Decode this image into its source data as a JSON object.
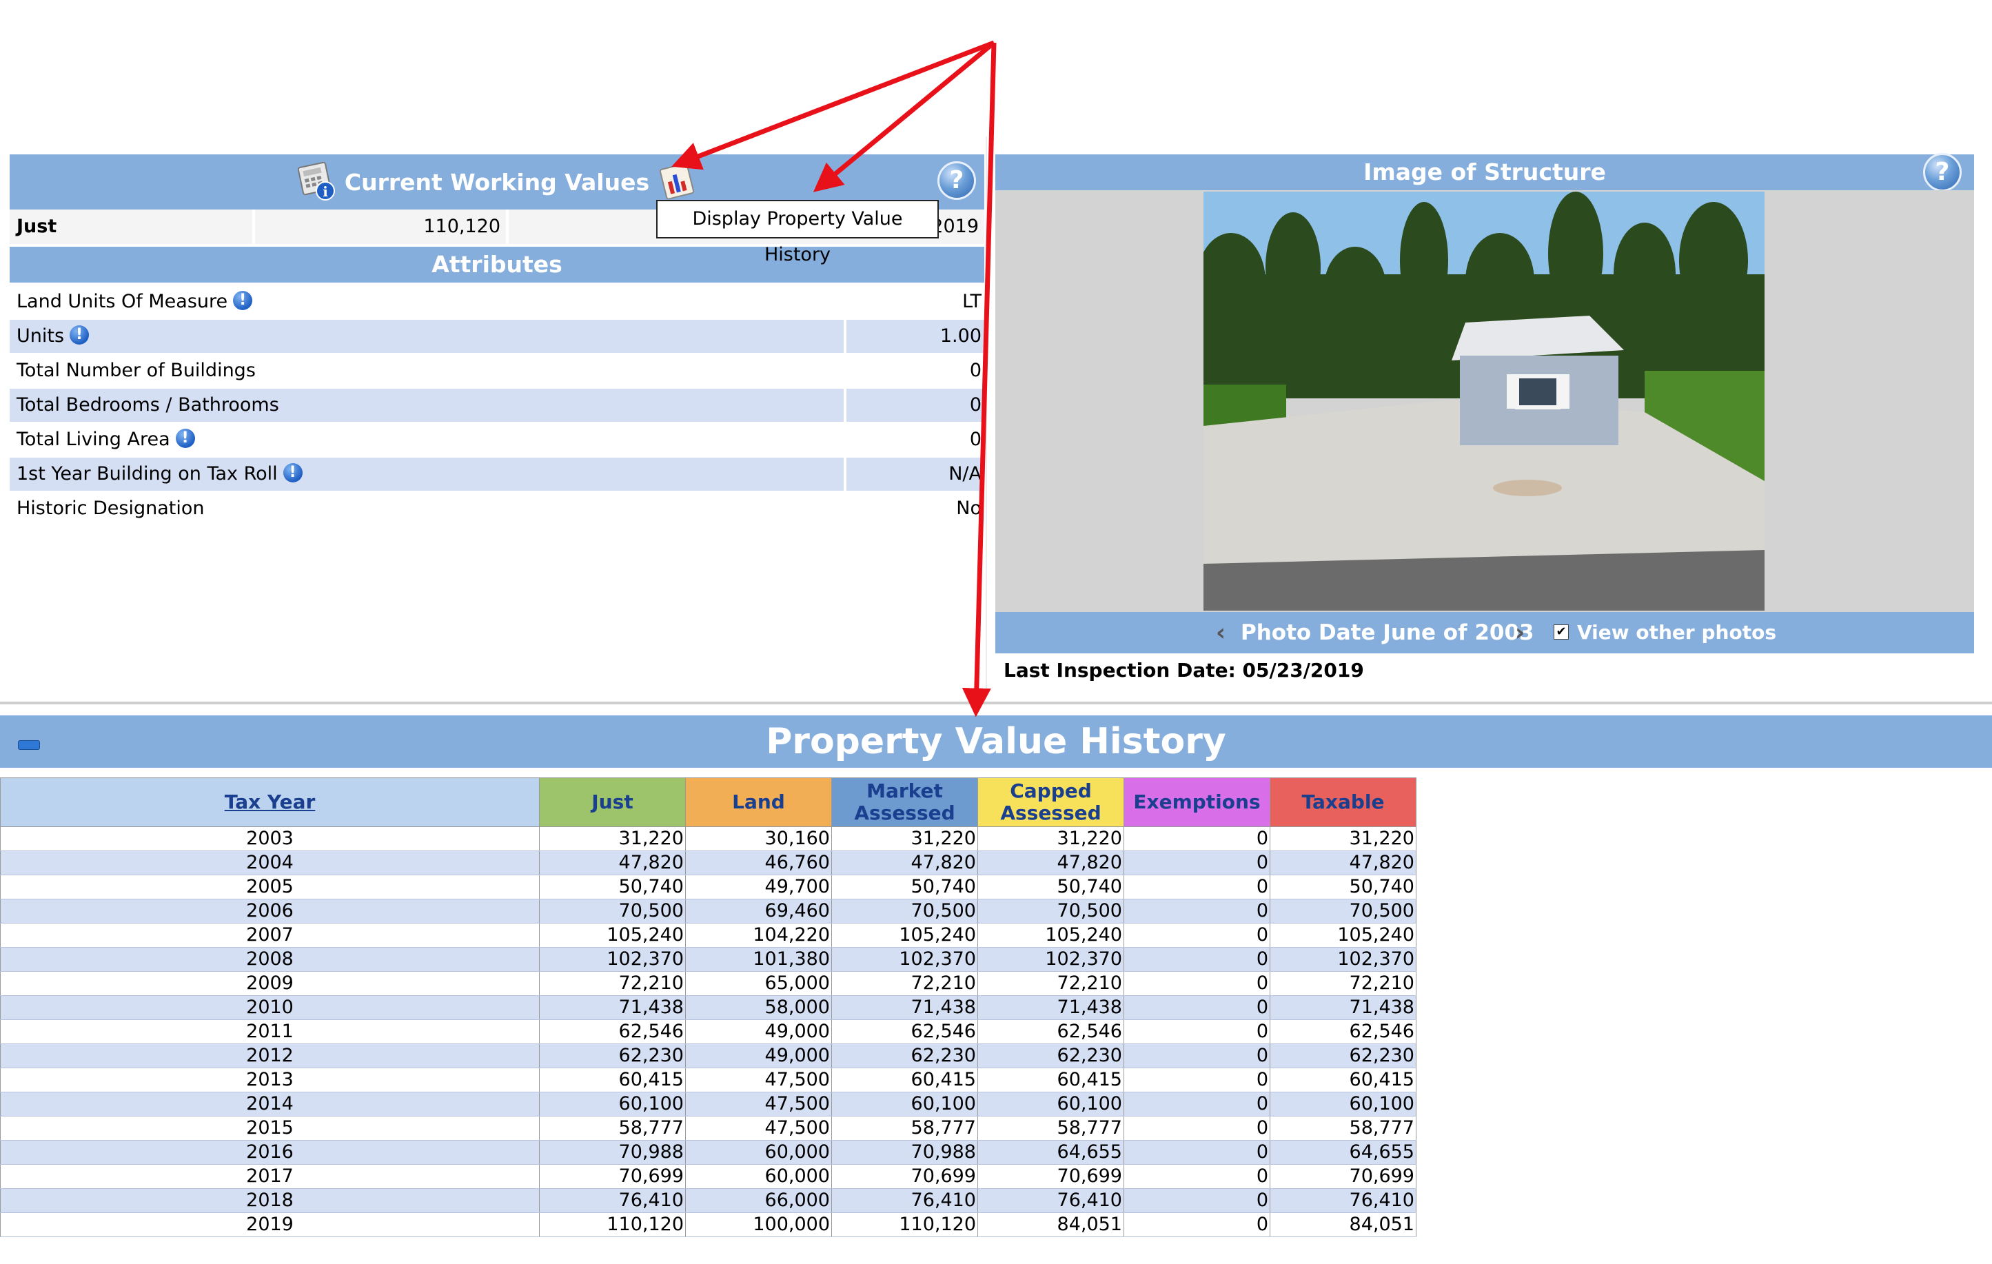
{
  "current_working_values": {
    "title": "Current Working Values",
    "just_label": "Just",
    "just_value": "110,120",
    "year_fragment": "2019",
    "tooltip": "Display Property Value History",
    "help": "?"
  },
  "attributes": {
    "title": "Attributes",
    "rows": [
      {
        "label": "Land Units Of Measure",
        "value": "LT"
      },
      {
        "label": "Units",
        "value": "1.00"
      },
      {
        "label": "Total Number of Buildings",
        "value": "0"
      },
      {
        "label": "Total Bedrooms / Bathrooms",
        "value": "0"
      },
      {
        "label": "Total Living Area",
        "value": "0"
      },
      {
        "label": "1st Year Building on Tax Roll",
        "value": "N/A"
      },
      {
        "label": "Historic Designation",
        "value": "No"
      }
    ]
  },
  "image_of_structure": {
    "title": "Image of Structure",
    "help": "?",
    "photo_date": "Photo Date June of 2003",
    "view_other": "View other photos",
    "check_mark": "✔",
    "last_inspection": "Last Inspection Date: 05/23/2019"
  },
  "property_value_history": {
    "title": "Property Value History",
    "columns": [
      "Tax Year",
      "Just",
      "Land",
      "Market Assessed",
      "Capped Assessed",
      "Exemptions",
      "Taxable"
    ],
    "colors": {
      "tax_year": "#bbd3ee",
      "just": "#9dc36b",
      "land": "#f2ae55",
      "market": "#6d9bd0",
      "capped": "#f7e05a",
      "exemptions": "#d86fe8",
      "taxable": "#e8615c"
    },
    "rows": [
      [
        "2003",
        "31,220",
        "30,160",
        "31,220",
        "31,220",
        "0",
        "31,220"
      ],
      [
        "2004",
        "47,820",
        "46,760",
        "47,820",
        "47,820",
        "0",
        "47,820"
      ],
      [
        "2005",
        "50,740",
        "49,700",
        "50,740",
        "50,740",
        "0",
        "50,740"
      ],
      [
        "2006",
        "70,500",
        "69,460",
        "70,500",
        "70,500",
        "0",
        "70,500"
      ],
      [
        "2007",
        "105,240",
        "104,220",
        "105,240",
        "105,240",
        "0",
        "105,240"
      ],
      [
        "2008",
        "102,370",
        "101,380",
        "102,370",
        "102,370",
        "0",
        "102,370"
      ],
      [
        "2009",
        "72,210",
        "65,000",
        "72,210",
        "72,210",
        "0",
        "72,210"
      ],
      [
        "2010",
        "71,438",
        "58,000",
        "71,438",
        "71,438",
        "0",
        "71,438"
      ],
      [
        "2011",
        "62,546",
        "49,000",
        "62,546",
        "62,546",
        "0",
        "62,546"
      ],
      [
        "2012",
        "62,230",
        "49,000",
        "62,230",
        "62,230",
        "0",
        "62,230"
      ],
      [
        "2013",
        "60,415",
        "47,500",
        "60,415",
        "60,415",
        "0",
        "60,415"
      ],
      [
        "2014",
        "60,100",
        "47,500",
        "60,100",
        "60,100",
        "0",
        "60,100"
      ],
      [
        "2015",
        "58,777",
        "47,500",
        "58,777",
        "58,777",
        "0",
        "58,777"
      ],
      [
        "2016",
        "70,988",
        "60,000",
        "70,988",
        "64,655",
        "0",
        "64,655"
      ],
      [
        "2017",
        "70,699",
        "60,000",
        "70,699",
        "70,699",
        "0",
        "70,699"
      ],
      [
        "2018",
        "76,410",
        "66,000",
        "76,410",
        "76,410",
        "0",
        "76,410"
      ],
      [
        "2019",
        "110,120",
        "100,000",
        "110,120",
        "84,051",
        "0",
        "84,051"
      ]
    ]
  },
  "annotation_color": "#e8111a"
}
